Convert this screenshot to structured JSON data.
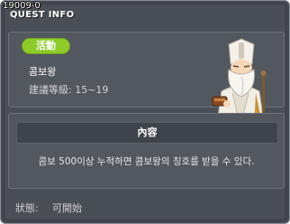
{
  "quest": {
    "id": "19009-0",
    "header": "QUEST INFO",
    "badge": "活動",
    "name": "콤보왕",
    "level": "建議等級: 15~19",
    "content_title": "內容",
    "content_text": "콤보 500이상 누적하면 콤보왕의 칭호를 받을 수 있다.",
    "status_label": "狀態:",
    "status_value": "可開始"
  },
  "colors": {
    "panel_bg": "#4a4e55",
    "badge_green": "#8ecb2a"
  },
  "icons": {
    "npc": "old-sage-npc-portrait"
  }
}
